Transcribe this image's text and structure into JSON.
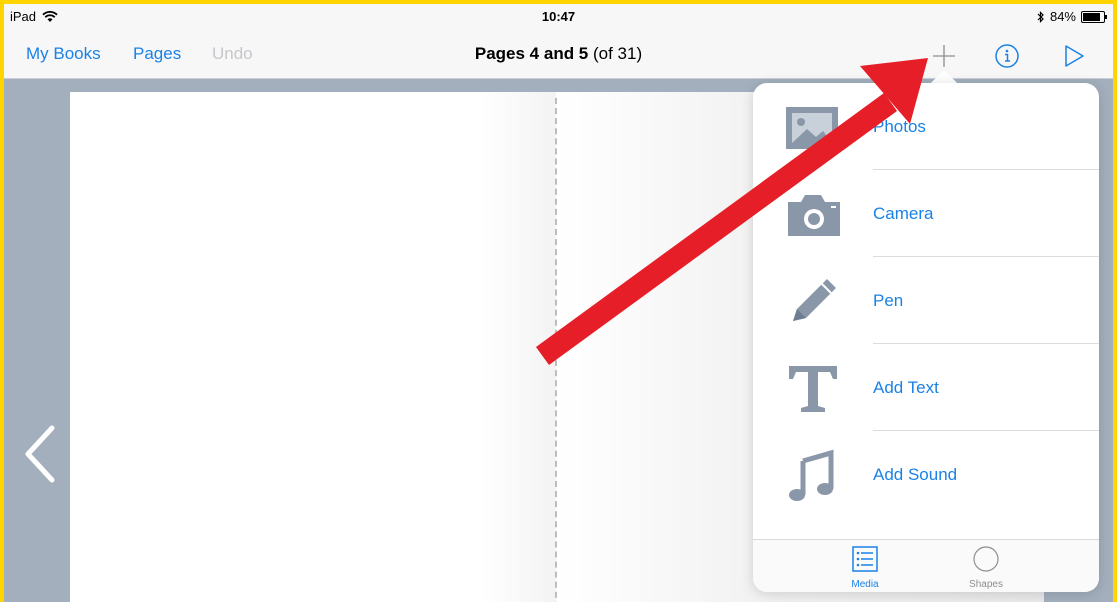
{
  "status": {
    "device": "iPad",
    "time": "10:47",
    "battery": "84%",
    "battery_level": 0.84
  },
  "nav": {
    "my_books": "My Books",
    "pages": "Pages",
    "undo": "Undo",
    "title_bold": "Pages 4 and 5",
    "title_rest": " (of 31)"
  },
  "menu": {
    "items": [
      {
        "label": "Photos",
        "icon": "photos-icon"
      },
      {
        "label": "Camera",
        "icon": "camera-icon"
      },
      {
        "label": "Pen",
        "icon": "pen-icon"
      },
      {
        "label": "Add Text",
        "icon": "text-icon"
      },
      {
        "label": "Add Sound",
        "icon": "music-note-icon"
      }
    ]
  },
  "tabs": {
    "media": "Media",
    "shapes": "Shapes"
  },
  "colors": {
    "accent": "#1a82e6",
    "frame": "#ffd400",
    "annotation_arrow": "#e61e28",
    "icon_gray": "#8a97a8"
  }
}
